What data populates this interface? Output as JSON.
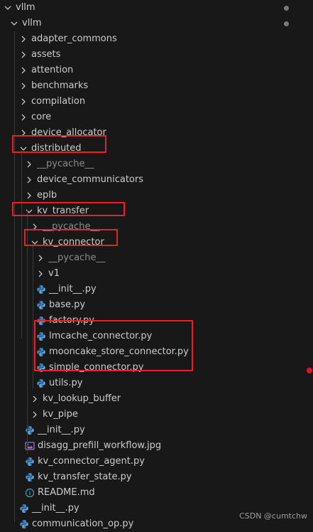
{
  "tree": {
    "items": [
      {
        "label": "vllm",
        "type": "folder",
        "open": true,
        "dot": true
      },
      {
        "label": "vllm",
        "type": "folder",
        "open": true,
        "dot": true
      },
      {
        "label": "adapter_commons",
        "type": "folder",
        "open": false
      },
      {
        "label": "assets",
        "type": "folder",
        "open": false
      },
      {
        "label": "attention",
        "type": "folder",
        "open": false
      },
      {
        "label": "benchmarks",
        "type": "folder",
        "open": false
      },
      {
        "label": "compilation",
        "type": "folder",
        "open": false
      },
      {
        "label": "core",
        "type": "folder",
        "open": false
      },
      {
        "label": "device_allocator",
        "type": "folder",
        "open": false
      },
      {
        "label": "distributed",
        "type": "folder",
        "open": true
      },
      {
        "label": "__pycache__",
        "type": "folder",
        "open": false,
        "dim": true
      },
      {
        "label": "device_communicators",
        "type": "folder",
        "open": false
      },
      {
        "label": "eplb",
        "type": "folder",
        "open": false
      },
      {
        "label": "kv_transfer",
        "type": "folder",
        "open": true
      },
      {
        "label": "__pycache__",
        "type": "folder",
        "open": false,
        "dim": true
      },
      {
        "label": "kv_connector",
        "type": "folder",
        "open": true
      },
      {
        "label": "__pycache__",
        "type": "folder",
        "open": false,
        "dim": true
      },
      {
        "label": "v1",
        "type": "folder",
        "open": false
      },
      {
        "label": "__init__.py",
        "type": "python"
      },
      {
        "label": "base.py",
        "type": "python"
      },
      {
        "label": "factory.py",
        "type": "python"
      },
      {
        "label": "lmcache_connector.py",
        "type": "python"
      },
      {
        "label": "mooncake_store_connector.py",
        "type": "python"
      },
      {
        "label": "simple_connector.py",
        "type": "python"
      },
      {
        "label": "utils.py",
        "type": "python"
      },
      {
        "label": "kv_lookup_buffer",
        "type": "folder",
        "open": false
      },
      {
        "label": "kv_pipe",
        "type": "folder",
        "open": false
      },
      {
        "label": "__init__.py",
        "type": "python"
      },
      {
        "label": "disagg_prefill_workflow.jpg",
        "type": "image"
      },
      {
        "label": "kv_connector_agent.py",
        "type": "python"
      },
      {
        "label": "kv_transfer_state.py",
        "type": "python"
      },
      {
        "label": "README.md",
        "type": "info"
      },
      {
        "label": "__init__.py",
        "type": "python"
      },
      {
        "label": "communication_op.py",
        "type": "python"
      }
    ]
  },
  "watermark": "CSDN @cumtchw",
  "colors": {
    "background": "#181818",
    "text": "#cccccc",
    "dim_text": "#8b8b8b",
    "python_icon": "#3f86c6",
    "highlight_box": "#e2252d",
    "error_dot": "#e81123"
  }
}
